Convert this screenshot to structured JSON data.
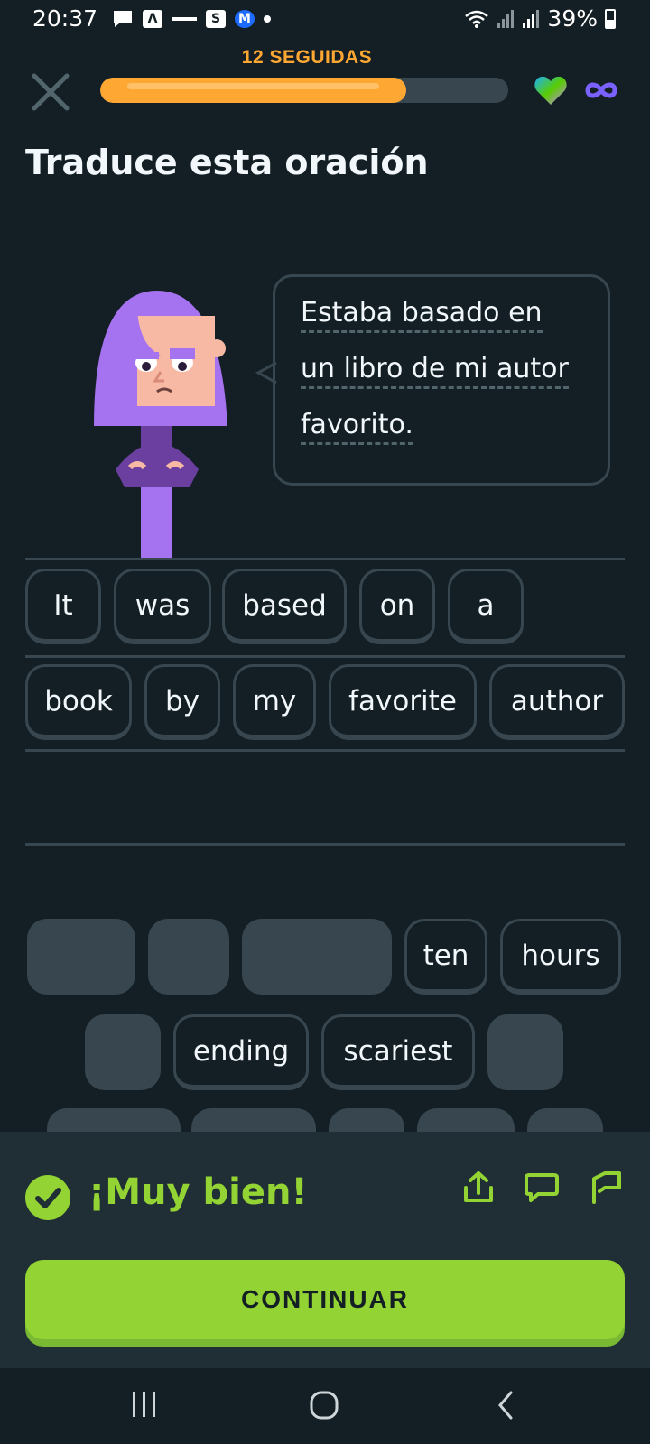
{
  "status_bar": {
    "time": "20:37",
    "battery": "39%",
    "notification_icons": [
      "chat-icon",
      "app-icon",
      "news-icon",
      "s-icon",
      "m-icon"
    ]
  },
  "header": {
    "streak": "12 SEGUIDAS",
    "progress": 0.75,
    "hearts_icon": "heart-icon",
    "unlimited_icon": "infinity-icon"
  },
  "title": "Traduce esta oración",
  "prompt": {
    "lines": [
      "Estaba basado en",
      "un libro de mi autor",
      "favorito."
    ]
  },
  "answer": {
    "row1": [
      "It",
      "was",
      "based",
      "on",
      "a"
    ],
    "row2": [
      "book",
      "by",
      "my",
      "favorite",
      "author"
    ]
  },
  "word_bank": {
    "row1_visible": [
      "ten",
      "hours"
    ],
    "row2_visible": [
      "ending",
      "scariest"
    ]
  },
  "feedback": {
    "message": "¡Muy bien!",
    "continue_label": "CONTINUAR"
  },
  "colors": {
    "background": "#131f24",
    "accent_green": "#93d333",
    "streak_orange": "#ffa733",
    "chip_border": "#37464f"
  }
}
